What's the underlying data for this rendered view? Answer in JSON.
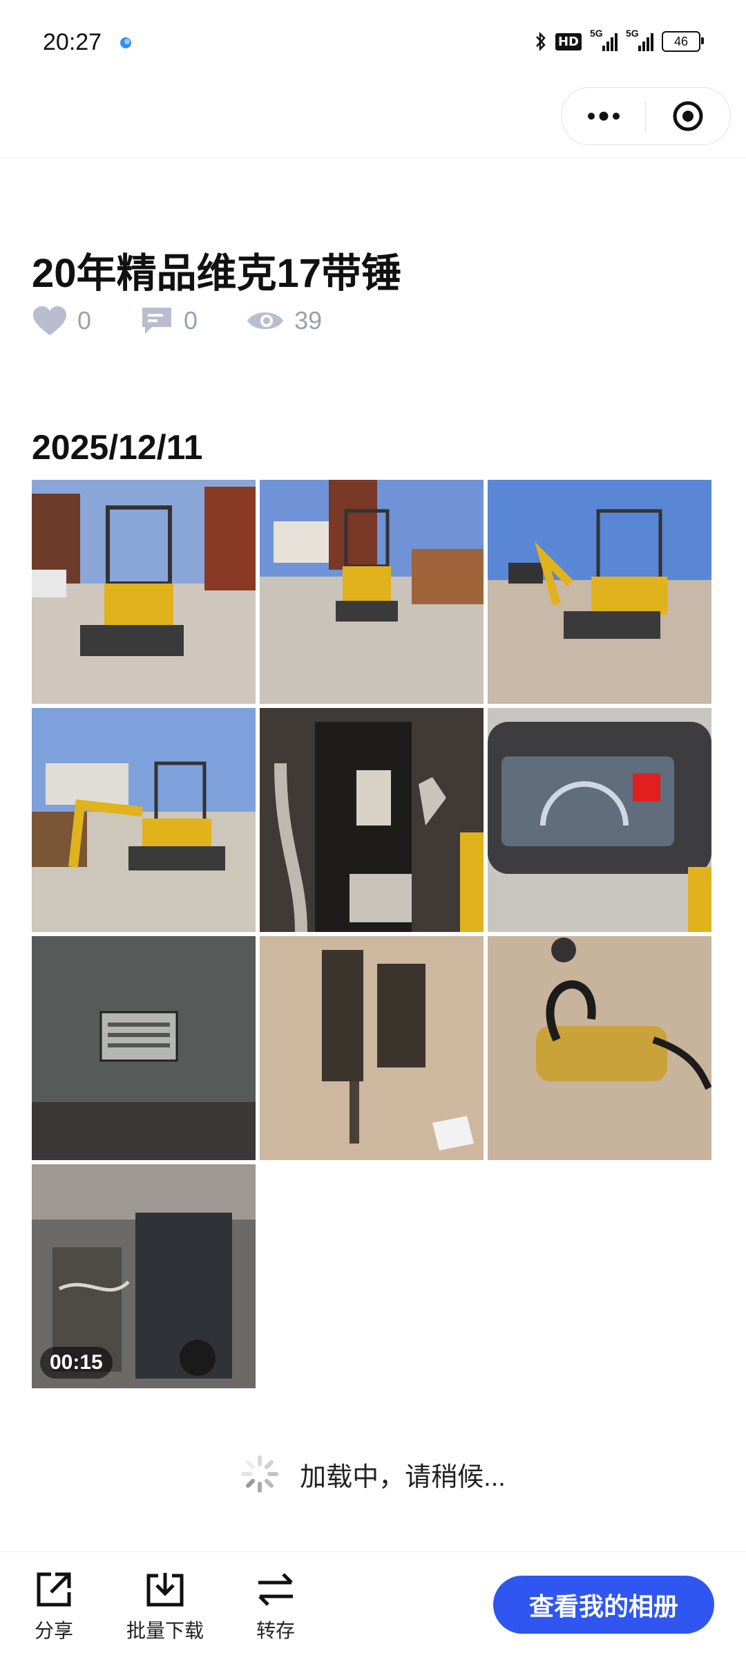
{
  "status_bar": {
    "time": "20:27",
    "hd_label": "HD",
    "network_1": "5G",
    "network_2": "5G",
    "battery": "46"
  },
  "nav": {
    "more_icon": "ellipsis-icon",
    "close_icon": "target-circle-icon"
  },
  "post": {
    "title": "20年精品维克17带锤",
    "likes": "0",
    "comments": "0",
    "views": "39"
  },
  "album": {
    "date": "2025/12/11",
    "photos": [
      {
        "kind": "excavator-front"
      },
      {
        "kind": "excavator-road"
      },
      {
        "kind": "excavator-side"
      },
      {
        "kind": "excavator-arm"
      },
      {
        "kind": "engine-bracket"
      },
      {
        "kind": "dashboard-display"
      },
      {
        "kind": "nameplate"
      },
      {
        "kind": "hammer-attachment"
      },
      {
        "kind": "hammer-hoses"
      },
      {
        "kind": "engine-video",
        "duration": "00:15"
      }
    ]
  },
  "loading_text": "加载中，请稍候...",
  "actions": {
    "share": "分享",
    "batch_download": "批量下载",
    "save": "转存",
    "view_album": "查看我的相册"
  },
  "colors": {
    "accent": "#2f56f1",
    "icon_gray": "#9aa0ad"
  }
}
